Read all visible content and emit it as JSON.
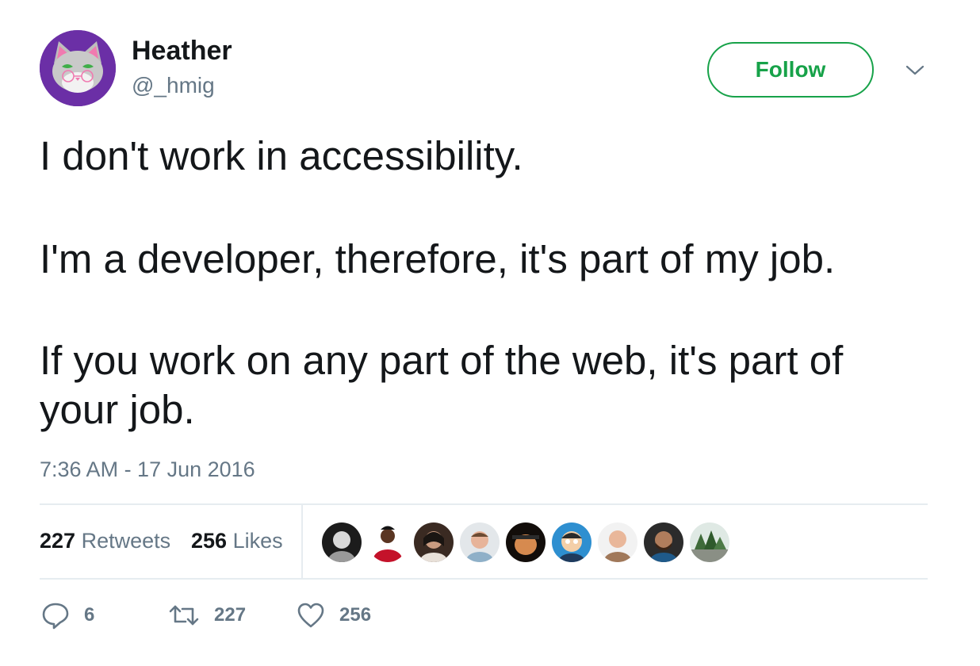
{
  "author": {
    "name": "Heather",
    "handle": "@_hmig"
  },
  "follow_label": "Follow",
  "tweet": {
    "paragraphs": [
      "I don't work in accessibility.",
      "I'm a developer, therefore, it's part of my job.",
      "If you work on any part of the web, it's part of your job."
    ],
    "timestamp": "7:36 AM - 17 Jun 2016"
  },
  "stats": {
    "retweets_count": "227",
    "retweets_label": "Retweets",
    "likes_count": "256",
    "likes_label": "Likes"
  },
  "actions": {
    "reply_count": "6",
    "retweet_count": "227",
    "like_count": "256"
  },
  "colors": {
    "follow_green": "#17a249",
    "muted_text": "#657786",
    "avatar_purple": "#6b2fa6"
  }
}
